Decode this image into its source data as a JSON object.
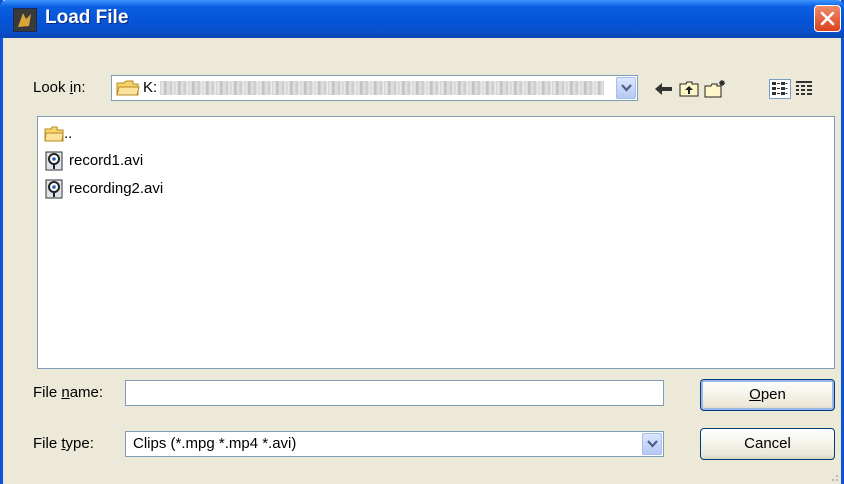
{
  "window": {
    "title": "Load File"
  },
  "lookin": {
    "label_pre": "Look ",
    "label_accel": "i",
    "label_post": "n:",
    "value": "K:"
  },
  "files": [
    {
      "name": "..",
      "icon": "folder-icon"
    },
    {
      "name": "record1.avi",
      "icon": "media-file-icon"
    },
    {
      "name": "recording2.avi",
      "icon": "media-file-icon"
    }
  ],
  "filename": {
    "label_pre": "File ",
    "label_accel": "n",
    "label_post": "ame:",
    "value": ""
  },
  "filetype": {
    "label_pre": "File ",
    "label_accel": "t",
    "label_post": "ype:",
    "value": "Clips (*.mpg *.mp4 *.avi)"
  },
  "buttons": {
    "open_accel": "O",
    "open_rest": "pen",
    "cancel": "Cancel"
  },
  "colors": {
    "titlebar": "#0654d8",
    "close": "#d9431d",
    "dialog_bg": "#ece9d8"
  }
}
